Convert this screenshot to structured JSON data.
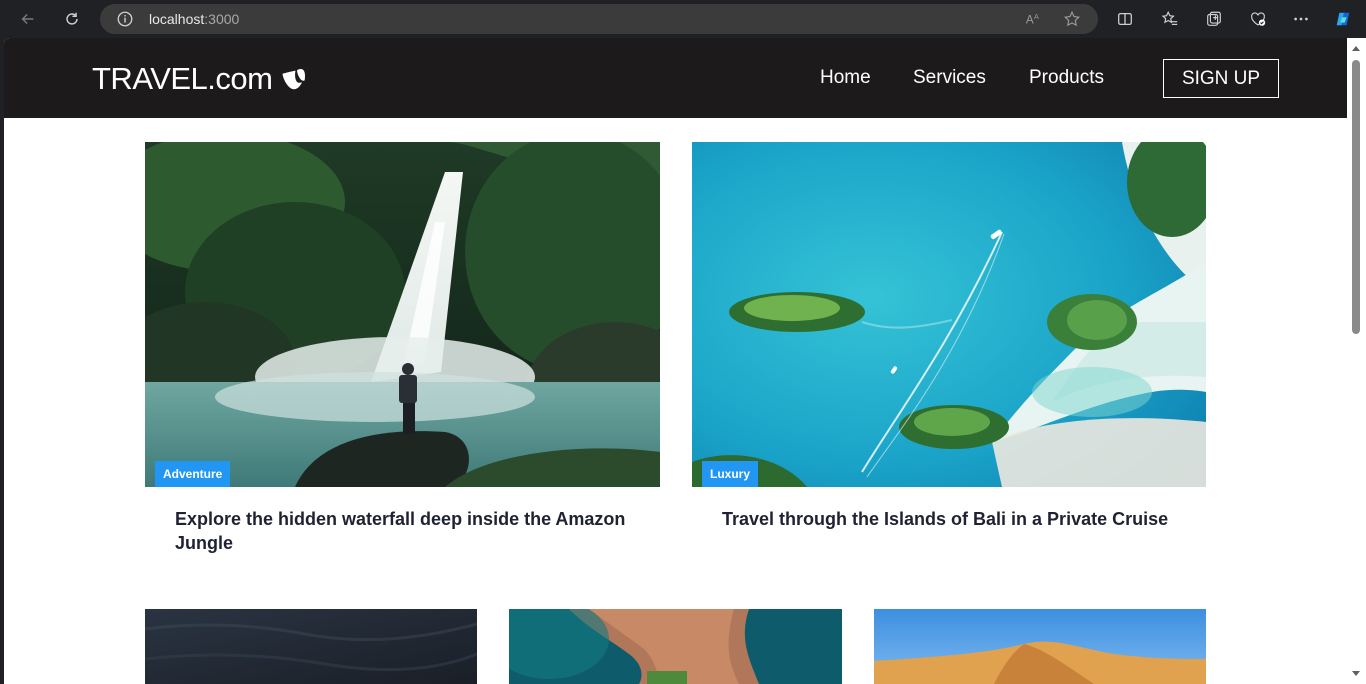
{
  "browser": {
    "url_host": "localhost",
    "url_port": ":3000"
  },
  "header": {
    "brand": "TRAVEL.com",
    "nav": [
      "Home",
      "Services",
      "Products"
    ],
    "signup_label": "SIGN UP"
  },
  "featured": [
    {
      "tag": "Adventure",
      "title": "Explore the hidden waterfall deep inside the Amazon Jungle"
    },
    {
      "tag": "Luxury",
      "title": "Travel through the Islands of Bali in a Private Cruise"
    }
  ],
  "colors": {
    "header_bg": "#1c1a1a",
    "tag_bg": "#2196f3",
    "title_text": "#1f2233"
  }
}
